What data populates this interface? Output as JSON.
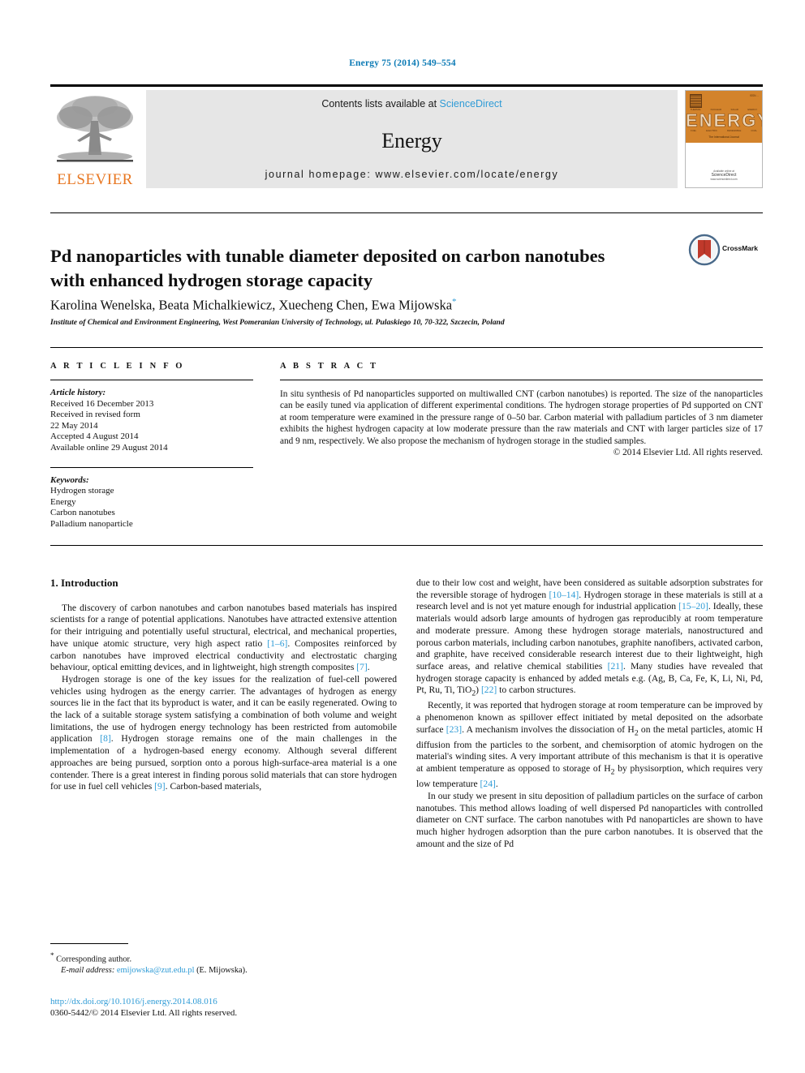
{
  "running_head": "Energy 75 (2014) 549–554",
  "masthead": {
    "contents_text": "Contents lists available at",
    "sciencedirect": "ScienceDirect",
    "journal_name": "Energy",
    "homepage": "journal homepage: www.elsevier.com/locate/energy",
    "publisher": "ELSEVIER",
    "colors": {
      "link": "#2e9bd6",
      "brand_orange": "#e87722",
      "banner_bg": "#e6e6e6"
    }
  },
  "cover": {
    "word": "ENERGY",
    "issue": "ISSN ...",
    "kicker": [
      "THERMAL",
      "NUCLEAR",
      "SOLAR",
      "ENERGY"
    ],
    "sub": [
      "FUEL",
      "ELECTRIC",
      "RENEWABLE",
      "COAL"
    ],
    "tagline": "The International Journal",
    "foot_small": "Available online at",
    "foot_brand": "ScienceDirect",
    "foot_url": "www.sciencedirect.com"
  },
  "article": {
    "title": "Pd nanoparticles with tunable diameter deposited on carbon nanotubes with enhanced hydrogen storage capacity",
    "authors": "Karolina Wenelska, Beata Michalkiewicz, Xuecheng Chen, Ewa Mijowska",
    "author_marker": "*",
    "affiliation": "Institute of Chemical and Environment Engineering, West Pomeranian University of Technology, ul. Pulaskiego 10, 70-322, Szczecin, Poland",
    "crossmark_label": "CrossMark"
  },
  "info": {
    "heading": "A R T I C L E   I N F O",
    "history_label": "Article history:",
    "history": [
      "Received 16 December 2013",
      "Received in revised form",
      "22 May 2014",
      "Accepted 4 August 2014",
      "Available online 29 August 2014"
    ],
    "keywords_label": "Keywords:",
    "keywords": [
      "Hydrogen storage",
      "Energy",
      "Carbon nanotubes",
      "Palladium nanoparticle"
    ]
  },
  "abstract": {
    "heading": "A B S T R A C T",
    "text": "In situ synthesis of Pd nanoparticles supported on multiwalled CNT (carbon nanotubes) is reported. The size of the nanoparticles can be easily tuned via application of different experimental conditions. The hydrogen storage properties of Pd supported on CNT at room temperature were examined in the pressure range of 0–50 bar. Carbon material with palladium particles of 3 nm diameter exhibits the highest hydrogen capacity at low moderate pressure than the raw materials and CNT with larger particles size of 17 and 9 nm, respectively. We also propose the mechanism of hydrogen storage in the studied samples.",
    "copyright": "© 2014 Elsevier Ltd. All rights reserved."
  },
  "body": {
    "section_heading": "1. Introduction",
    "left": {
      "p1_a": "The discovery of carbon nanotubes and carbon nanotubes based materials has inspired scientists for a range of potential applications. Nanotubes have attracted extensive attention for their intriguing and potentially useful structural, electrical, and mechanical properties, have unique atomic structure, very high aspect ratio ",
      "p1_cite1": "[1–6]",
      "p1_b": ". Composites reinforced by carbon nanotubes have improved electrical conductivity and electrostatic charging behaviour, optical emitting devices, and in lightweight, high strength composites ",
      "p1_cite2": "[7]",
      "p1_c": ".",
      "p2_a": "Hydrogen storage is one of the key issues for the realization of fuel-cell powered vehicles using hydrogen as the energy carrier. The advantages of hydrogen as energy sources lie in the fact that its byproduct is water, and it can be easily regenerated. Owing to the lack of a suitable storage system satisfying a combination of both volume and weight limitations, the use of hydrogen energy technology has been restricted from automobile application ",
      "p2_cite1": "[8]",
      "p2_b": ". Hydrogen storage remains one of the main challenges in the implementation of a hydrogen-based energy economy. Although several different approaches are being pursued, sorption onto a porous high-surface-area material is a one contender. There is a great interest in finding porous solid materials that can store hydrogen for use in fuel cell vehicles ",
      "p2_cite2": "[9]",
      "p2_c": ". Carbon-based materials,"
    },
    "right": {
      "p3_a": "due to their low cost and weight, have been considered as suitable adsorption substrates for the reversible storage of hydrogen ",
      "p3_cite1": "[10–14]",
      "p3_b": ". Hydrogen storage in these materials is still at a research level and is not yet mature enough for industrial application ",
      "p3_cite2": "[15–20]",
      "p3_c": ". Ideally, these materials would adsorb large amounts of hydrogen gas reproducibly at room temperature and moderate pressure. Among these hydrogen storage materials, nanostructured and porous carbon materials, including carbon nanotubes, graphite nanofibers, activated carbon, and graphite, have received considerable research interest due to their lightweight, high surface areas, and relative chemical stabilities ",
      "p3_cite3": "[21]",
      "p3_d": ". Many studies have revealed that hydrogen storage capacity is enhanced by added metals e.g. (Ag, B, Ca, Fe, K, Li, Ni, Pd, Pt, Ru, Ti, TiO",
      "p3_sub": "2",
      "p3_e": ") ",
      "p3_cite4": "[22]",
      "p3_f": " to carbon structures.",
      "p4_a": "Recently, it was reported that hydrogen storage at room temperature can be improved by a phenomenon known as spillover effect initiated by metal deposited on the adsorbate surface ",
      "p4_cite1": "[23]",
      "p4_b": ". A mechanism involves the dissociation of H",
      "p4_sub1": "2",
      "p4_c": " on the metal particles, atomic H diffusion from the particles to the sorbent, and chemisorption of atomic hydrogen on the material's winding sites. A very important attribute of this mechanism is that it is operative at ambient temperature as opposed to storage of H",
      "p4_sub2": "2",
      "p4_d": " by physisorption, which requires very low temperature ",
      "p4_cite2": "[24]",
      "p4_e": ".",
      "p5": "In our study we present in situ deposition of palladium particles on the surface of carbon nanotubes. This method allows loading of well dispersed Pd nanoparticles with controlled diameter on CNT surface. The carbon nanotubes with Pd nanoparticles are shown to have much higher hydrogen adsorption than the pure carbon nanotubes. It is observed that the amount and the size of Pd"
    }
  },
  "footnotes": {
    "corresponding": "Corresponding author.",
    "email_label": "E-mail address:",
    "email": "emijowska@zut.edu.pl",
    "email_owner": "(E. Mijowska).",
    "doi": "http://dx.doi.org/10.1016/j.energy.2014.08.016",
    "issn_line": "0360-5442/© 2014 Elsevier Ltd. All rights reserved."
  }
}
